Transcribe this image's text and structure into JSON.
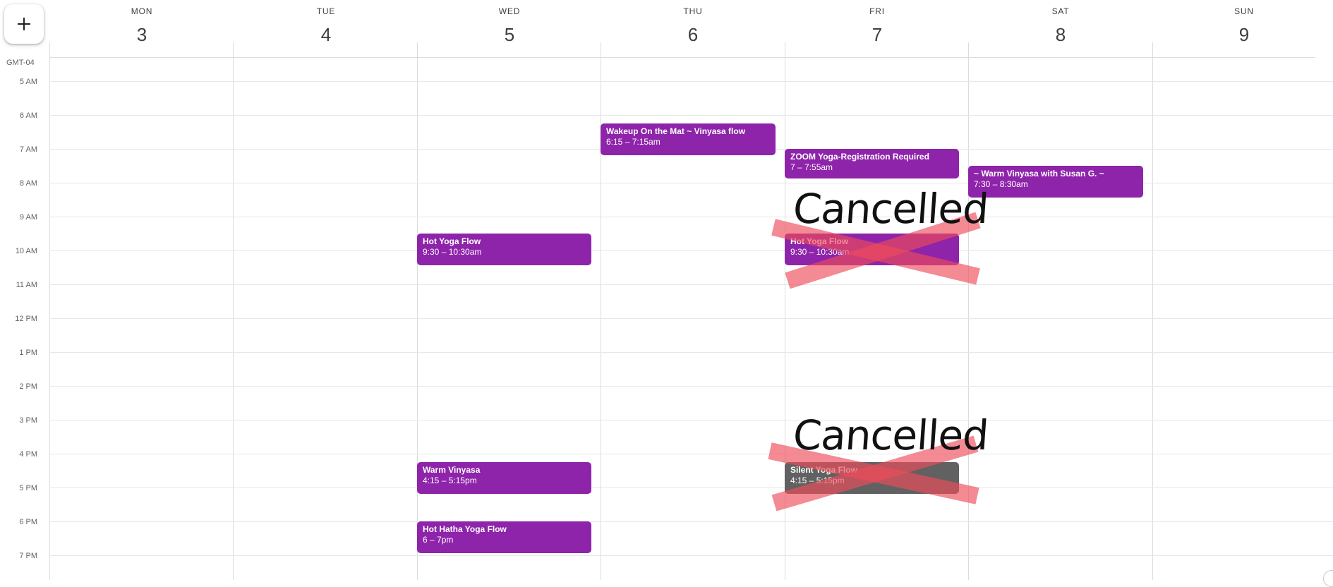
{
  "toolbar": {
    "create_label": "+"
  },
  "timezone": "GMT-04",
  "days": [
    {
      "dow": "MON",
      "date": "3"
    },
    {
      "dow": "TUE",
      "date": "4"
    },
    {
      "dow": "WED",
      "date": "5"
    },
    {
      "dow": "THU",
      "date": "6"
    },
    {
      "dow": "FRI",
      "date": "7"
    },
    {
      "dow": "SAT",
      "date": "8"
    },
    {
      "dow": "SUN",
      "date": "9"
    }
  ],
  "hours": [
    "5 AM",
    "6 AM",
    "7 AM",
    "8 AM",
    "9 AM",
    "10 AM",
    "11 AM",
    "12 PM",
    "1 PM",
    "2 PM",
    "3 PM",
    "4 PM",
    "5 PM",
    "6 PM",
    "7 PM"
  ],
  "events": [
    {
      "id": "ev0",
      "title": "Wakeup On the Mat ~ Vinyasa flow",
      "time": "6:15 – 7:15am",
      "color": "#8e24aa"
    },
    {
      "id": "ev1",
      "title": "ZOOM Yoga-Registration Required",
      "time": "7 – 7:55am",
      "color": "#8e24aa"
    },
    {
      "id": "ev2",
      "title": "~ Warm Vinyasa with Susan G. ~",
      "time": "7:30 – 8:30am",
      "color": "#8e24aa"
    },
    {
      "id": "ev3",
      "title": "Hot Yoga Flow",
      "time": "9:30 – 10:30am",
      "color": "#8e24aa"
    },
    {
      "id": "ev4",
      "title": "Hot Yoga Flow",
      "time": "9:30 – 10:30am",
      "color": "#8e24aa"
    },
    {
      "id": "ev5",
      "title": "Warm Vinyasa",
      "time": "4:15 – 5:15pm",
      "color": "#8e24aa"
    },
    {
      "id": "ev6",
      "title": "Silent Yoga Flow",
      "time": "4:15 – 5:15pm",
      "color": "#616161"
    },
    {
      "id": "ev7",
      "title": "Hot Hatha Yoga Flow",
      "time": "6 – 7pm",
      "color": "#8e24aa"
    }
  ],
  "annotations": {
    "cancel_1": "Cancelled",
    "cancel_2": "Cancelled"
  },
  "colors": {
    "event_purple": "#8e24aa",
    "event_gray": "#616161",
    "strike_red": "#ee4b5a"
  }
}
